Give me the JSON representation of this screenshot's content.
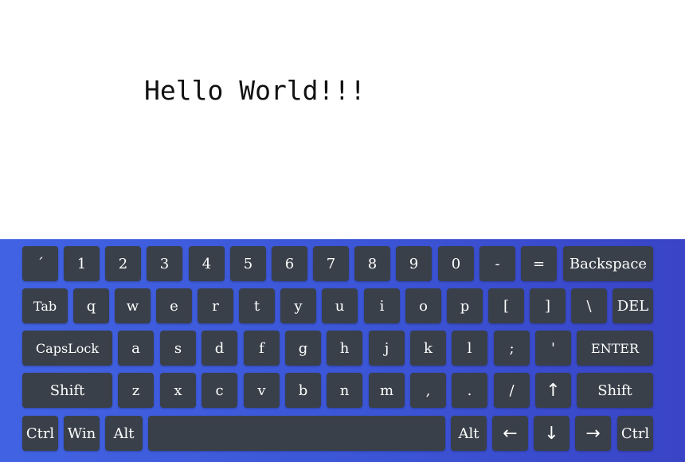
{
  "output": {
    "text": "Hello World!!!"
  },
  "keyboard": {
    "row1": [
      "´",
      "1",
      "2",
      "3",
      "4",
      "5",
      "6",
      "7",
      "8",
      "9",
      "0",
      "-",
      "=",
      "Backspace"
    ],
    "row2": [
      "Tab",
      "q",
      "w",
      "e",
      "r",
      "t",
      "y",
      "u",
      "i",
      "o",
      "p",
      "[",
      "]",
      "\\",
      "DEL"
    ],
    "row3": [
      "CapsLock",
      "a",
      "s",
      "d",
      "f",
      "g",
      "h",
      "j",
      "k",
      "l",
      ";",
      "'",
      "ENTER"
    ],
    "row4": [
      "Shift",
      "z",
      "x",
      "c",
      "v",
      "b",
      "n",
      "m",
      ",",
      ".",
      "/",
      "↑",
      "Shift"
    ],
    "row5": [
      "Ctrl",
      "Win",
      "Alt",
      "",
      "Alt",
      "←",
      "↓",
      "→",
      "Ctrl"
    ]
  },
  "colors": {
    "key_background": "#394049",
    "key_text": "#ffffff",
    "keyboard_gradient_start": "#4163e3",
    "keyboard_gradient_end": "#3a44c6"
  }
}
